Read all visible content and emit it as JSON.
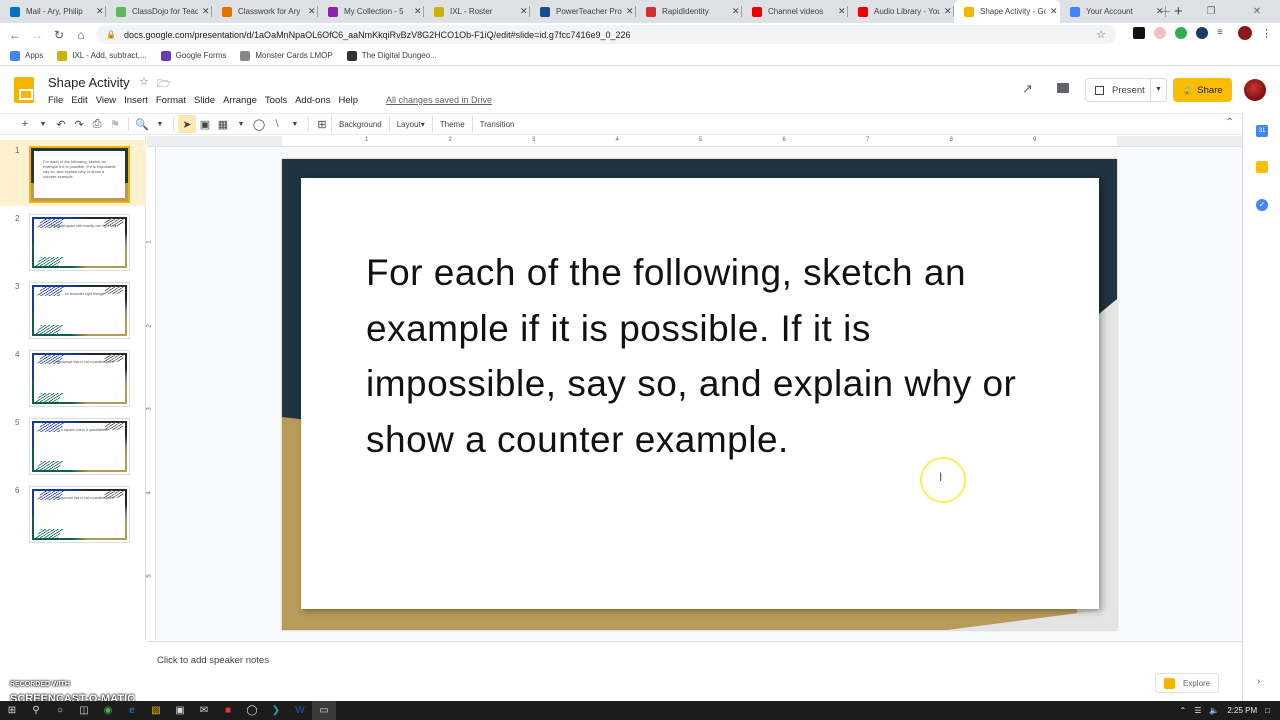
{
  "browser": {
    "tabs": [
      {
        "label": "Mail - Ary, Philip",
        "icon": "outlook-icon",
        "color": "#0072c6"
      },
      {
        "label": "ClassDojo for Teachers",
        "icon": "classdojo-icon",
        "color": "#5cb85c"
      },
      {
        "label": "Classwork for Ary",
        "icon": "classroom-icon",
        "color": "#e37400"
      },
      {
        "label": "My Collection - 5",
        "icon": "peardeck-icon",
        "color": "#8e24aa"
      },
      {
        "label": "IXL - Roster",
        "icon": "ixl-icon",
        "color": "#c8b400"
      },
      {
        "label": "PowerTeacher Pro",
        "icon": "powerteacher-icon",
        "color": "#1a4e8a"
      },
      {
        "label": "RapidIdentity",
        "icon": "rapididentity-icon",
        "color": "#d32f2f"
      },
      {
        "label": "Channel videos",
        "icon": "youtube-icon",
        "color": "#e00"
      },
      {
        "label": "Audio Library - YouTube",
        "icon": "youtube-icon",
        "color": "#e00"
      },
      {
        "label": "Shape Activity - Google Slides",
        "icon": "slides-icon",
        "color": "#f4b400",
        "active": true
      },
      {
        "label": "Your Account",
        "icon": "account-icon",
        "color": "#4285f4"
      }
    ],
    "new_tab": "+",
    "url": "docs.google.com/presentation/d/1aOaMnNpaOL6OfC6_aaNmKkqiRvBzV8G2HCO1Ob-F1iQ/edit#slide=id.g7fcc7416e9_0_226",
    "bookmarks": [
      {
        "label": "Apps",
        "color": "#4285f4"
      },
      {
        "label": "IXL - Add, subtract,...",
        "color": "#c8b400"
      },
      {
        "label": "Google Forms",
        "color": "#673ab7"
      },
      {
        "label": "Monster Cards LMOP",
        "color": "#888"
      },
      {
        "label": "The Digital Dungeo...",
        "color": "#333"
      }
    ]
  },
  "docs": {
    "title": "Shape Activity",
    "menu": [
      "File",
      "Edit",
      "View",
      "Insert",
      "Format",
      "Slide",
      "Arrange",
      "Tools",
      "Add-ons",
      "Help"
    ],
    "save_status": "All changes saved in Drive",
    "present_label": "Present",
    "share_label": "Share",
    "toolbar": {
      "background": "Background",
      "layout": "Layout",
      "theme": "Theme",
      "transition": "Transition"
    },
    "ruler_h": [
      "1",
      "2",
      "3",
      "4",
      "5",
      "6",
      "7",
      "8",
      "9"
    ],
    "ruler_v": [
      "1",
      "2",
      "3",
      "4",
      "5"
    ]
  },
  "slides": [
    {
      "num": "1",
      "text": "For each of the following, sketch an example if it is possible. If it is impossible, say so, and explain why or show a counter example.",
      "active": true
    },
    {
      "num": "2",
      "text": "A parallelogram with exactly one right angle"
    },
    {
      "num": "3",
      "text": "An isosceles right triangle"
    },
    {
      "num": "4",
      "text": "A rectangle that is not a parallelogram"
    },
    {
      "num": "5",
      "text": "A square that is a quadrilateral"
    },
    {
      "num": "6",
      "text": "A trapezoid that is not a parallelogram"
    }
  ],
  "current_slide": {
    "text": "For each of the following, sketch an example if it is possible. If it is impossible, say so, and explain why or show a counter example."
  },
  "notes": {
    "placeholder": "Click to add speaker notes"
  },
  "explore_label": "Explore",
  "watermark": {
    "line1": "RECORDED WITH",
    "line2": "SCREENCAST-O-MATIC"
  },
  "taskbar": {
    "time": "2:25 PM"
  }
}
